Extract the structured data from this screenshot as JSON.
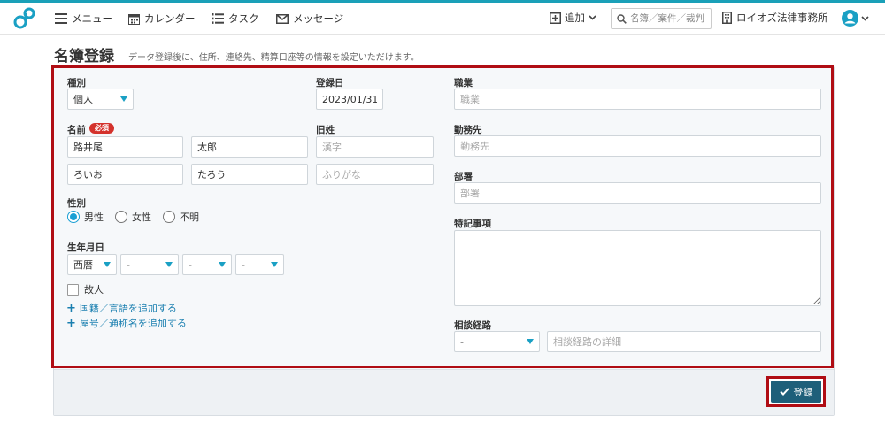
{
  "topbar": {
    "menu_label": "メニュー",
    "calendar_label": "カレンダー",
    "task_label": "タスク",
    "message_label": "メッセージ",
    "add_label": "追加",
    "search_placeholder": "名簿／案件／裁判",
    "office_name": "ロイオズ法律事務所"
  },
  "page": {
    "title": "名簿登録",
    "subtitle": "データ登録後に、住所、連絡先、精算口座等の情報を設定いただけます。"
  },
  "form": {
    "type_label": "種別",
    "type_value": "個人",
    "reg_date_label": "登録日",
    "reg_date_value": "2023/01/31",
    "name_label": "名前",
    "required_badge": "必須",
    "last_name": "路井尾",
    "first_name": "太郎",
    "last_name_kana": "ろいお",
    "first_name_kana": "たろう",
    "old_surname_label": "旧姓",
    "old_surname_placeholder": "漢字",
    "old_surname_kana_placeholder": "ふりがな",
    "gender_label": "性別",
    "gender_options": [
      "男性",
      "女性",
      "不明"
    ],
    "gender_selected": "男性",
    "birth_label": "生年月日",
    "era_value": "西暦",
    "year_value": "-",
    "month_value": "-",
    "day_value": "-",
    "deceased_label": "故人",
    "add_nationality_label": "国籍／言語を追加する",
    "add_alias_label": "屋号／通称名を追加する",
    "occupation_label": "職業",
    "occupation_placeholder": "職業",
    "employer_label": "勤務先",
    "employer_placeholder": "勤務先",
    "department_label": "部署",
    "department_placeholder": "部署",
    "notes_label": "特記事項",
    "consult_label": "相談経路",
    "consult_value": "-",
    "consult_detail_placeholder": "相談経路の詳細"
  },
  "actions": {
    "submit_label": "登録"
  },
  "colors": {
    "accent": "#1aa0c4",
    "highlight_frame": "#b00d14",
    "submit_bg": "#1e5f7a",
    "required_bg": "#d4322c",
    "link": "#1a7fb0"
  }
}
